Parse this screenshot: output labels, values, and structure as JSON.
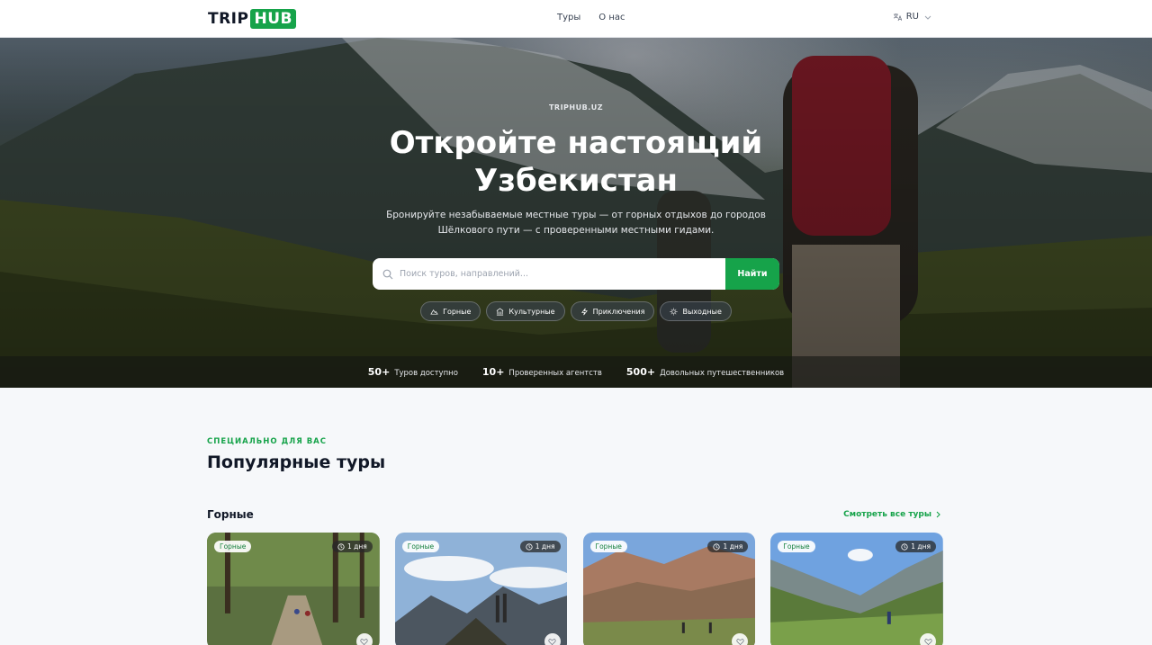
{
  "header": {
    "logo_trip": "TRIP",
    "logo_hub": "HUB",
    "nav": [
      "Туры",
      "О нас"
    ],
    "lang": "RU"
  },
  "hero": {
    "eyebrow": "TRIPHUB.UZ",
    "title_line1": "Откройте настоящий",
    "title_line2": "Узбекистан",
    "subtitle": "Бронируйте незабываемые местные туры — от горных отдыхов до городов Шёлкового пути — с проверенными местными гидами.",
    "search_placeholder": "Поиск туров, направлений...",
    "search_button": "Найти",
    "chips": [
      {
        "label": "Горные",
        "icon": "mountain-icon"
      },
      {
        "label": "Культурные",
        "icon": "landmark-icon"
      },
      {
        "label": "Приключения",
        "icon": "lightning-icon"
      },
      {
        "label": "Выходные",
        "icon": "sun-icon"
      }
    ],
    "stats": [
      {
        "num": "50+",
        "label": "Туров доступно"
      },
      {
        "num": "10+",
        "label": "Проверенных агентств"
      },
      {
        "num": "500+",
        "label": "Довольных путешественников"
      }
    ]
  },
  "section": {
    "eyebrow": "СПЕЦИАЛЬНО ДЛЯ ВАС",
    "title": "Популярные туры",
    "category": "Горные",
    "see_all": "Смотреть все туры"
  },
  "cards": [
    {
      "badge": "Горные",
      "duration": "1 дня"
    },
    {
      "badge": "Горные",
      "duration": "1 дня"
    },
    {
      "badge": "Горные",
      "duration": "1 дня"
    },
    {
      "badge": "Горные",
      "duration": "1 дня"
    }
  ],
  "colors": {
    "accent": "#16a34a",
    "text": "#111827",
    "bg": "#f6f8fa"
  }
}
